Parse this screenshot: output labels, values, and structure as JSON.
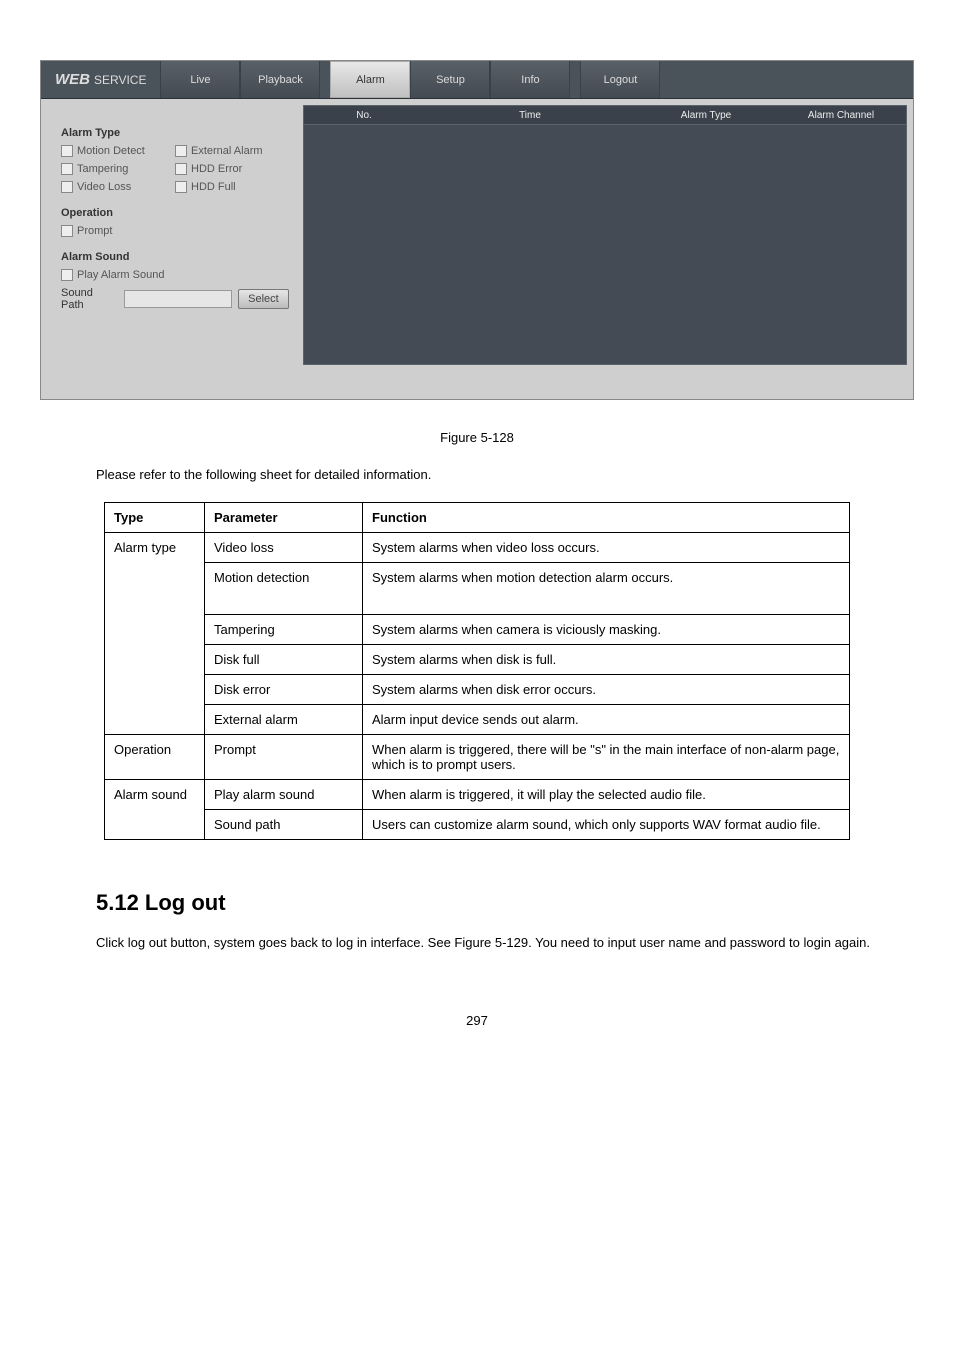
{
  "screenshot": {
    "logo_bold": "WEB",
    "logo_sub": "SERVICE",
    "tabs": {
      "live": "Live",
      "playback": "Playback",
      "alarm": "Alarm",
      "setup": "Setup",
      "info": "Info",
      "logout": "Logout"
    },
    "left": {
      "alarm_type_title": "Alarm Type",
      "motion_detect": "Motion Detect",
      "external_alarm": "External Alarm",
      "tampering": "Tampering",
      "hdd_error": "HDD Error",
      "video_loss": "Video Loss",
      "hdd_full": "HDD Full",
      "operation_title": "Operation",
      "prompt": "Prompt",
      "alarm_sound_title": "Alarm Sound",
      "play_alarm_sound": "Play Alarm Sound",
      "sound_path_label": "Sound Path",
      "select_btn": "Select"
    },
    "table": {
      "no": "No.",
      "time": "Time",
      "type": "Alarm Type",
      "channel": "Alarm Channel"
    }
  },
  "caption": "Figure 5-128",
  "lead": "Please refer to the following sheet for detailed information.",
  "table_rows": [
    {
      "type": "Alarm type",
      "param": "Video loss",
      "func": "System alarms when video loss occurs."
    },
    {
      "type": "",
      "param": "Motion detection",
      "func": "System alarms when motion detection alarm occurs."
    },
    {
      "type": "",
      "param": "Tampering",
      "func": "System alarms when camera is viciously masking."
    },
    {
      "type": "",
      "param": "Disk full",
      "func": "System alarms when disk is full."
    },
    {
      "type": "",
      "param": "Disk error",
      "func": "System alarms when disk error occurs."
    },
    {
      "type": "",
      "param": "External alarm",
      "func": "Alarm input device sends out alarm."
    },
    {
      "type": "Operation",
      "param": "Prompt",
      "func": "When alarm is triggered, there will be \"s\" in the main interface of non-alarm page, which is to prompt users."
    },
    {
      "type": "Alarm sound",
      "param": "Play alarm sound",
      "func": "When alarm is triggered, it will play the selected audio file."
    },
    {
      "type": "",
      "param": "Sound path",
      "func": "Users can customize alarm sound, which only supports WAV format audio file."
    }
  ],
  "headers": {
    "type": "Type",
    "param": "Parameter",
    "func": "Function"
  },
  "section_heading": "5.12 Log out",
  "para": "Click log out button, system goes back to log in interface. See Figure 5-129. You need to input user name and password to login again.",
  "page_number": "297"
}
